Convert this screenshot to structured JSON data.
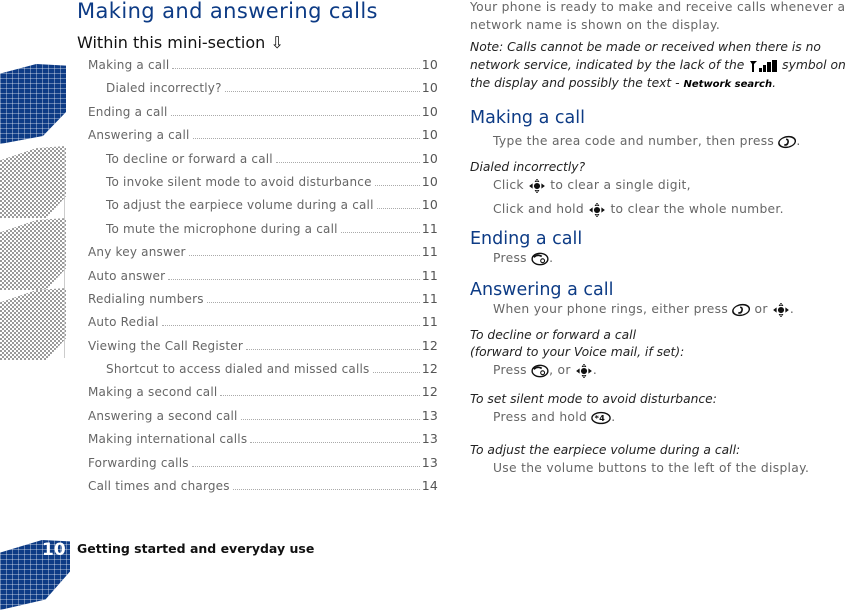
{
  "page": {
    "title": "Making and answering calls",
    "mini_section_heading": "Within this mini-section ⇩",
    "page_number": "10",
    "footer_section": "Getting started and everyday use"
  },
  "toc": [
    {
      "label": "Making a call",
      "page": "10",
      "level": 1
    },
    {
      "label": "Dialed incorrectly?",
      "page": "10",
      "level": 2
    },
    {
      "label": "Ending a call",
      "page": "10",
      "level": 1
    },
    {
      "label": "Answering a call",
      "page": "10",
      "level": 1
    },
    {
      "label": "To decline or forward a call",
      "page": "10",
      "level": 2
    },
    {
      "label": "To invoke silent mode to avoid disturbance",
      "page": "10",
      "level": 2
    },
    {
      "label": "To adjust the earpiece volume during a call",
      "page": "10",
      "level": 2
    },
    {
      "label": "To mute the microphone during a call",
      "page": "11",
      "level": 2
    },
    {
      "label": "Any key answer",
      "page": "11",
      "level": 1
    },
    {
      "label": "Auto answer",
      "page": "11",
      "level": 1
    },
    {
      "label": "Redialing numbers",
      "page": "11",
      "level": 1
    },
    {
      "label": "Auto Redial",
      "page": "11",
      "level": 1
    },
    {
      "label": "Viewing the Call Register",
      "page": "12",
      "level": 1
    },
    {
      "label": "Shortcut to access dialed and missed calls",
      "page": "12",
      "level": 2
    },
    {
      "label": "Making a second call",
      "page": "12",
      "level": 1
    },
    {
      "label": "Answering a second call",
      "page": "13",
      "level": 1
    },
    {
      "label": "Making international calls",
      "page": "13",
      "level": 1
    },
    {
      "label": "Forwarding calls",
      "page": "13",
      "level": 1
    },
    {
      "label": "Call times and charges",
      "page": "14",
      "level": 1
    }
  ],
  "content": {
    "intro": "Your phone is ready to make and receive calls whenever a network name is shown on the display.",
    "note_before": "Note: Calls cannot be made or received when there is no network service, indicated by the lack of the",
    "note_icon": "signal-strength-icon",
    "note_after": "symbol on the display and possibly the text -",
    "note_display_text": "Network search",
    "note_end": ".",
    "making": {
      "heading": "Making a call",
      "text_before": "Type the area code and number, then press",
      "icon": "send-key-icon",
      "text_after": ".",
      "sub_heading": "Dialed incorrectly?",
      "line1_before": "Click",
      "line1_icon": "navigation-key-icon",
      "line1_after": "to clear a single digit,",
      "line2_before": "Click and hold",
      "line2_icon": "navigation-key-icon",
      "line2_after": "to clear the whole number."
    },
    "ending": {
      "heading": "Ending a call",
      "text_before": "Press",
      "icon": "end-key-icon",
      "text_after": "."
    },
    "answering": {
      "heading": "Answering a call",
      "text_before": "When your phone rings, either press",
      "icon1": "send-key-icon",
      "text_mid": "or",
      "icon2": "navigation-key-icon",
      "text_after": ".",
      "decline_heading_1": "To decline or forward a call",
      "decline_heading_2": "(forward to your Voice mail, if set):",
      "decline_before": "Press",
      "decline_icon1": "end-key-icon",
      "decline_mid": ", or",
      "decline_icon2": "navigation-key-icon",
      "decline_after": ".",
      "silent_heading": "To set silent mode to avoid disturbance:",
      "silent_before": "Press and hold",
      "silent_icon": "star-key-icon",
      "silent_after": ".",
      "volume_heading": "To adjust the earpiece volume during a call:",
      "volume_text": "Use the volume buttons to the left of the display."
    }
  },
  "colors": {
    "accent": "#0d3b85",
    "body_text": "#666666",
    "heading_text": "#222222"
  }
}
